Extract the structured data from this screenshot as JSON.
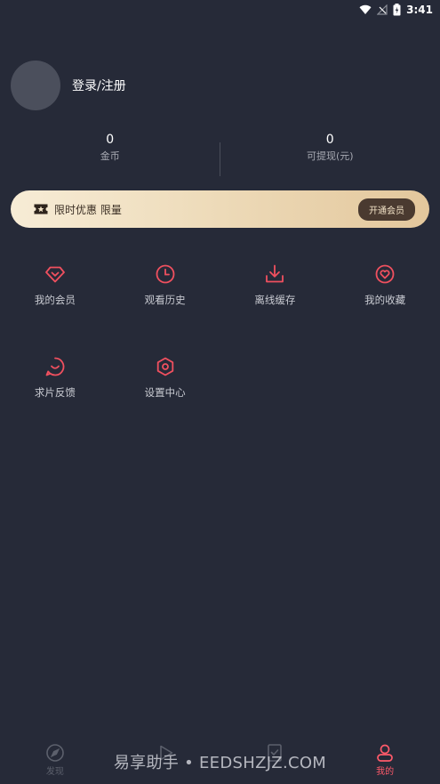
{
  "status_bar": {
    "time": "3:41"
  },
  "profile": {
    "login_label": "登录/注册"
  },
  "stats": [
    {
      "value": "0",
      "label": "金币"
    },
    {
      "value": "0",
      "label": "可提现(元)"
    }
  ],
  "vip_banner": {
    "text": "限时优惠 限量",
    "button_label": "开通会员"
  },
  "menu": [
    {
      "label": "我的会员",
      "icon": "diamond-icon"
    },
    {
      "label": "观看历史",
      "icon": "clock-icon"
    },
    {
      "label": "离线缓存",
      "icon": "download-icon"
    },
    {
      "label": "我的收藏",
      "icon": "heart-icon"
    },
    {
      "label": "求片反馈",
      "icon": "feedback-icon"
    },
    {
      "label": "设置中心",
      "icon": "settings-icon"
    }
  ],
  "tabbar": [
    {
      "label": "发现",
      "icon": "compass-icon",
      "active": false
    },
    {
      "label": "",
      "icon": "play-icon",
      "active": false
    },
    {
      "label": "",
      "icon": "task-icon",
      "active": false
    },
    {
      "label": "我的",
      "icon": "user-icon",
      "active": true
    }
  ],
  "watermark": "易享助手 • EEDSHZJZ.COM",
  "colors": {
    "background": "#262a38",
    "accent": "#ff5a6a",
    "icon_red": "#f0505f",
    "vip_gold": "#e8d2ad"
  }
}
